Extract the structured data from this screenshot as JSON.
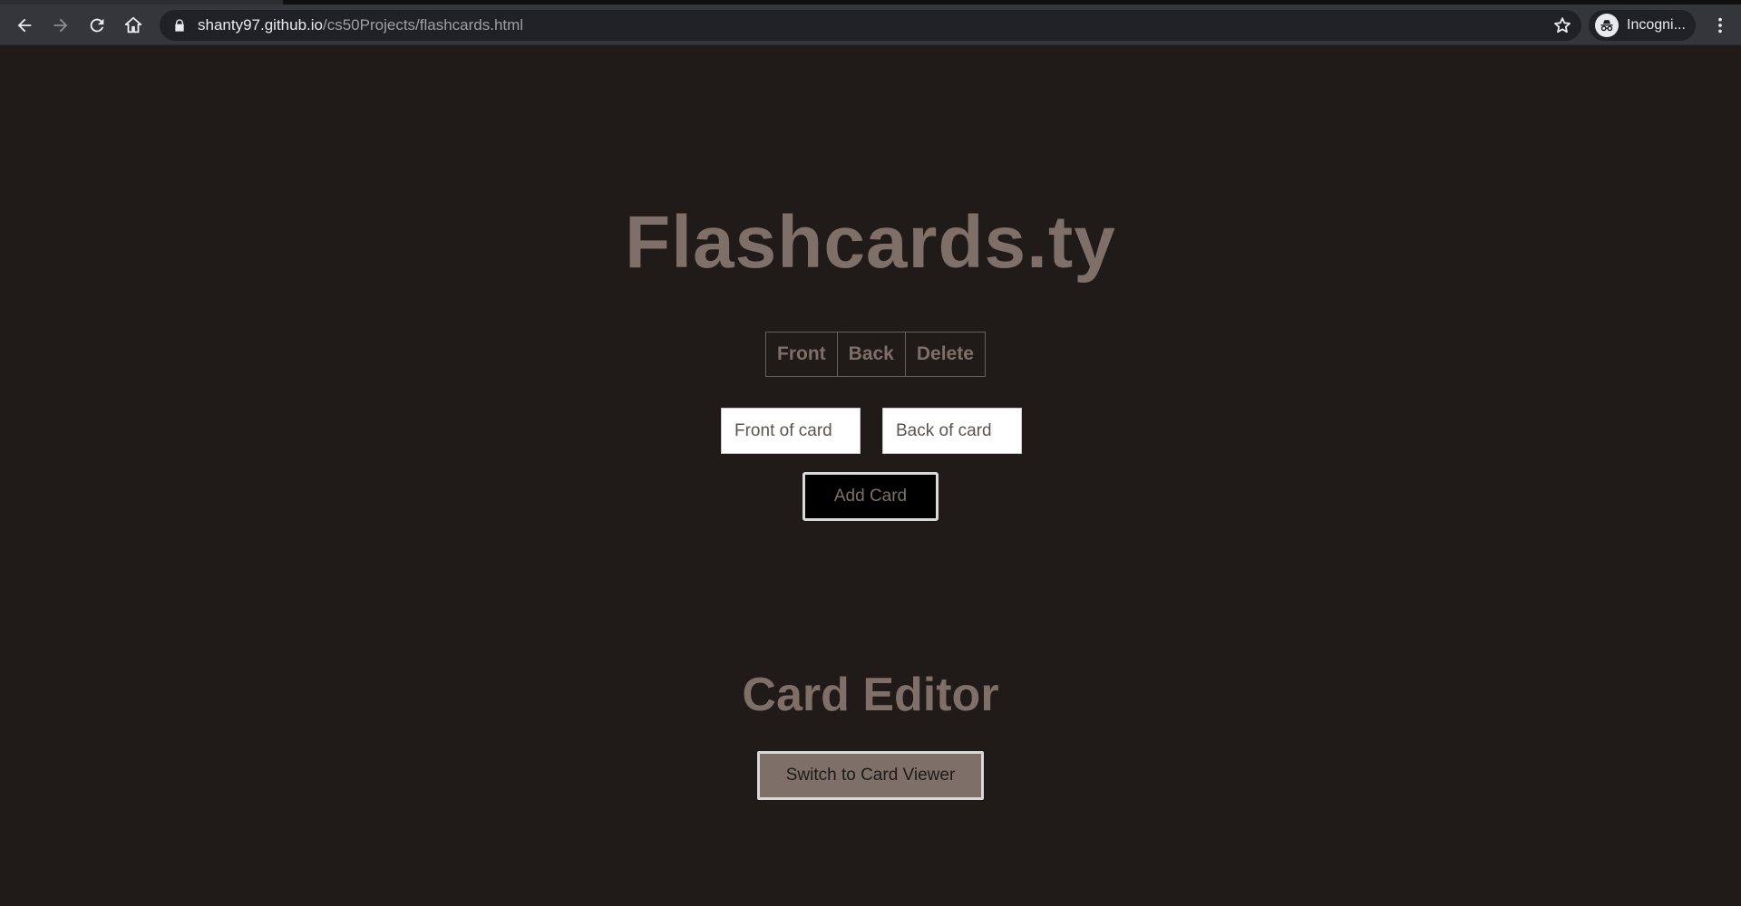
{
  "browser": {
    "url_host": "shanty97.github.io",
    "url_path": "/cs50Projects/flashcards.html",
    "profile_label": "Incogni..."
  },
  "page": {
    "title": "Flashcards.ty",
    "table_headers": [
      "Front",
      "Back",
      "Delete"
    ],
    "front_input": {
      "placeholder": "Front of card",
      "value": ""
    },
    "back_input": {
      "placeholder": "Back of card",
      "value": ""
    },
    "add_button_label": "Add Card",
    "section_title": "Card Editor",
    "switch_button_label": "Switch to Card Viewer"
  },
  "colors": {
    "background": "#201a18",
    "accent_text": "#7e6f69",
    "chrome_toolbar": "#35363a",
    "omnibox": "#202124"
  },
  "icons": [
    "back-arrow-icon",
    "forward-arrow-icon",
    "reload-icon",
    "home-icon",
    "lock-icon",
    "star-icon",
    "incognito-icon",
    "kebab-menu-icon"
  ]
}
